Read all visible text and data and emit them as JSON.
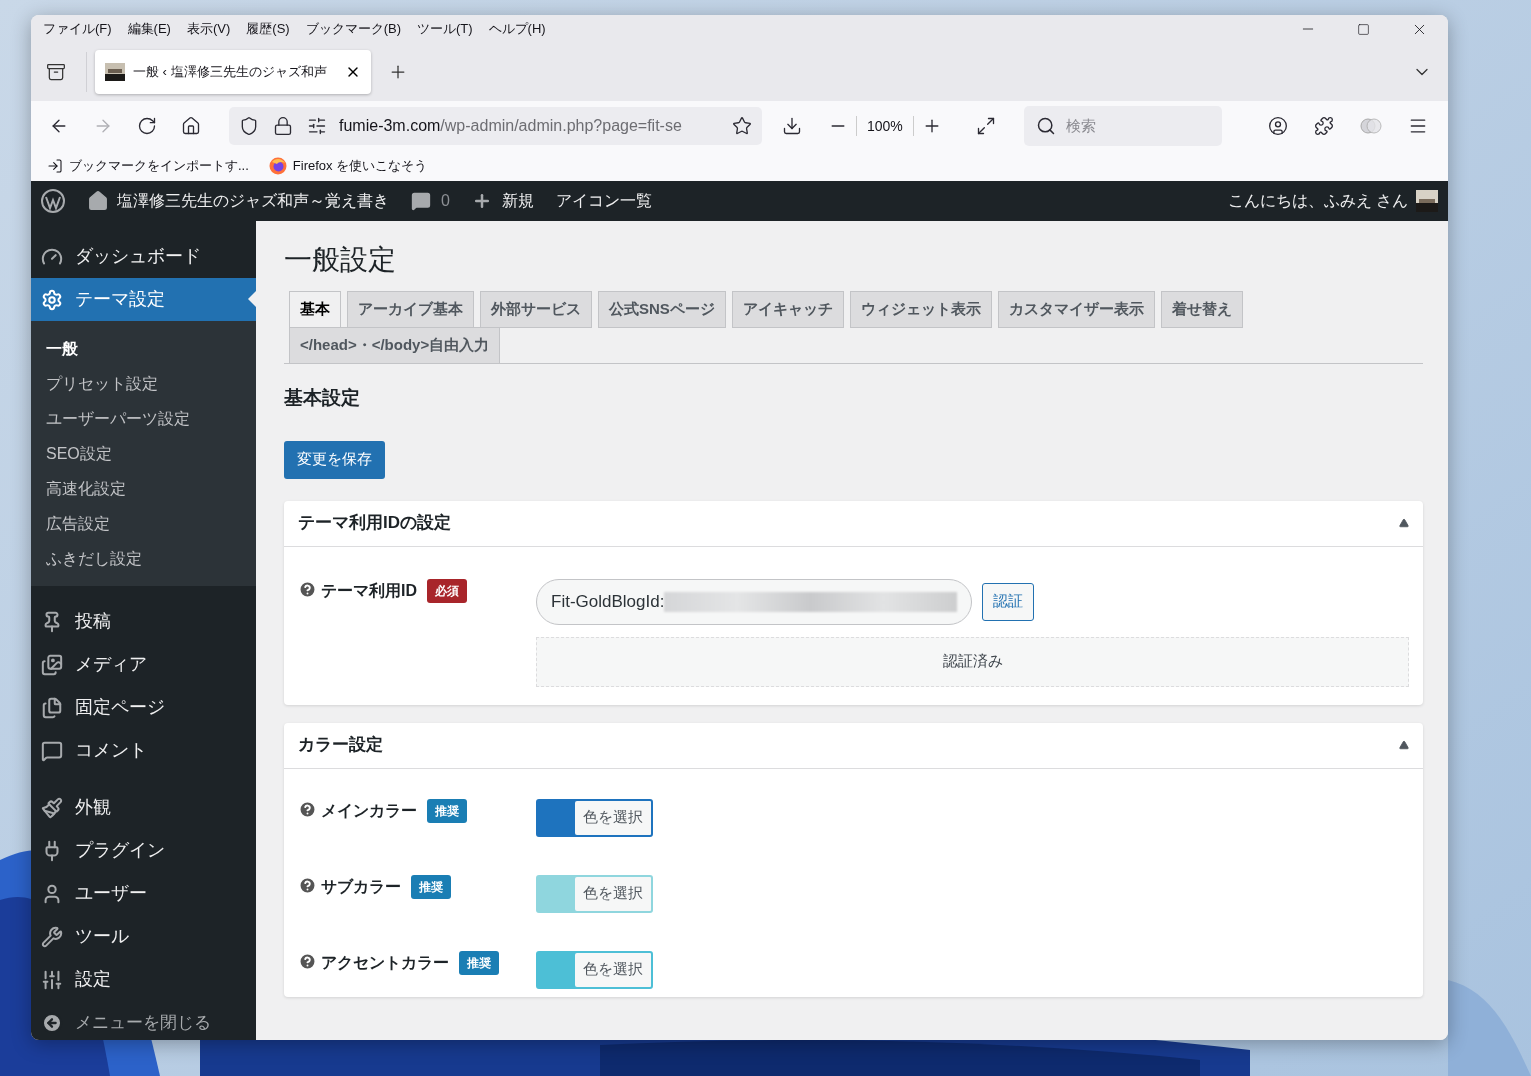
{
  "menu_bar": [
    "ファイル(F)",
    "編集(E)",
    "表示(V)",
    "履歴(S)",
    "ブックマーク(B)",
    "ツール(T)",
    "ヘルプ(H)"
  ],
  "tab": {
    "title": "一般 ‹ 塩澤修三先生のジャズ和声",
    "selected": true
  },
  "toolbar": {
    "forward_disabled": true,
    "url_host": "fumie-3m.com",
    "url_path": "/wp-admin/admin.php?page=fit-se",
    "zoom": "100%",
    "search_placeholder": "検索"
  },
  "bookmarks": [
    "ブックマークをインポートす...",
    "Firefox を使いこなそう"
  ],
  "admin_bar": {
    "site": "塩澤修三先生のジャズ和声～覚え書き",
    "comments": "0",
    "new": "新規",
    "icons": "アイコン一覧",
    "greeting": "こんにちは、ふみえ さん"
  },
  "sidebar": {
    "groups": [
      [
        {
          "label": "ダッシュボード",
          "selected": false
        },
        {
          "label": "テーマ設定",
          "selected": true,
          "children": [
            {
              "label": "一般",
              "selected": true
            },
            {
              "label": "プリセット設定",
              "selected": false
            },
            {
              "label": "ユーザーパーツ設定",
              "selected": false
            },
            {
              "label": "SEO設定",
              "selected": false
            },
            {
              "label": "高速化設定",
              "selected": false
            },
            {
              "label": "広告設定",
              "selected": false
            },
            {
              "label": "ふきだし設定",
              "selected": false
            }
          ]
        }
      ],
      [
        {
          "label": "投稿",
          "selected": false
        },
        {
          "label": "メディア",
          "selected": false
        },
        {
          "label": "固定ページ",
          "selected": false
        },
        {
          "label": "コメント",
          "selected": false
        }
      ],
      [
        {
          "label": "外観",
          "selected": false
        },
        {
          "label": "プラグイン",
          "selected": false
        },
        {
          "label": "ユーザー",
          "selected": false
        },
        {
          "label": "ツール",
          "selected": false
        },
        {
          "label": "設定",
          "selected": false
        }
      ]
    ],
    "collapse": "メニューを閉じる"
  },
  "main": {
    "title": "一般設定",
    "tabs": [
      {
        "label": "基本",
        "selected": true
      },
      {
        "label": "アーカイブ基本",
        "selected": false
      },
      {
        "label": "外部サービス",
        "selected": false
      },
      {
        "label": "公式SNSページ",
        "selected": false
      },
      {
        "label": "アイキャッチ",
        "selected": false
      },
      {
        "label": "ウィジェット表示",
        "selected": false
      },
      {
        "label": "カスタマイザー表示",
        "selected": false
      },
      {
        "label": "着せ替え",
        "selected": false
      },
      {
        "label": "</head>・</body>自由入力",
        "selected": false
      }
    ],
    "section_title": "基本設定",
    "save_button": "変更を保存",
    "cards": [
      {
        "title": "テーマ利用IDの設定",
        "expanded": true,
        "rows": [
          {
            "kind": "id",
            "label": "テーマ利用ID",
            "badge": {
              "text": "必須",
              "kind": "required"
            },
            "value": "Fit-GoldBlogId:",
            "button": "認証",
            "status": "認証済み"
          }
        ]
      },
      {
        "title": "カラー設定",
        "expanded": true,
        "rows": [
          {
            "kind": "color",
            "label": "メインカラー",
            "badge": {
              "text": "推奨",
              "kind": "recommended"
            },
            "color": "#1e73be",
            "button": "色を選択"
          },
          {
            "kind": "color",
            "label": "サブカラー",
            "badge": {
              "text": "推奨",
              "kind": "recommended"
            },
            "color": "#8fd6de",
            "button": "色を選択"
          },
          {
            "kind": "color",
            "label": "アクセントカラー",
            "badge": {
              "text": "推奨",
              "kind": "recommended"
            },
            "color": "#4dbfd6",
            "button": "色を選択"
          }
        ]
      }
    ]
  }
}
